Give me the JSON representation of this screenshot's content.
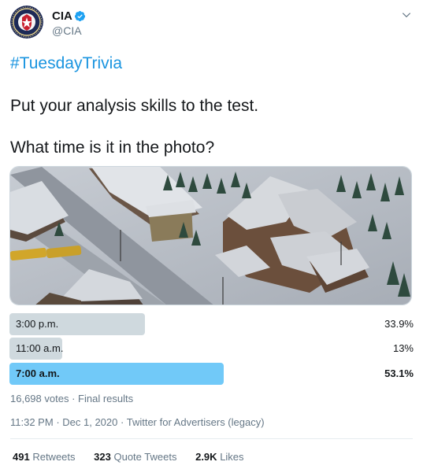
{
  "author": {
    "name": "CIA",
    "handle": "@CIA",
    "verified": true,
    "avatar_icon": "cia-seal-icon"
  },
  "tweet": {
    "hashtag": "#TuesdayTrivia",
    "line1": "Put your analysis skills to the test.",
    "line2": "What time is it in the photo?"
  },
  "poll": {
    "choices": [
      {
        "label": "3:00 p.m.",
        "percent_text": "33.9%",
        "percent": 33.9,
        "winner": false
      },
      {
        "label": "11:00 a.m.",
        "percent_text": "13%",
        "percent": 13,
        "winner": false
      },
      {
        "label": "7:00 a.m.",
        "percent_text": "53.1%",
        "percent": 53.1,
        "winner": true
      }
    ],
    "votes_text": "16,698 votes",
    "status_text": "Final results"
  },
  "meta": {
    "time": "11:32 PM",
    "date": "Dec 1, 2020",
    "source": "Twitter for Advertisers (legacy)"
  },
  "stats": {
    "retweets_count": "491",
    "retweets_label": "Retweets",
    "quotes_count": "323",
    "quotes_label": "Quote Tweets",
    "likes_count": "2.9K",
    "likes_label": "Likes"
  },
  "colors": {
    "link": "#1b95e0",
    "poll_bar": "#cfd9de",
    "poll_bar_winner": "#71c9f8",
    "verified": "#1da1f2"
  }
}
